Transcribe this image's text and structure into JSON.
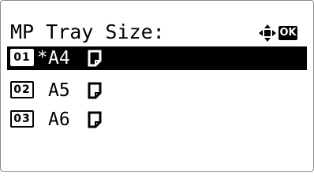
{
  "header": {
    "title": "MP Tray Size:",
    "nav_icon": "four-way-arrow-icon",
    "ok_label": "OK"
  },
  "items": [
    {
      "num": "01",
      "marker": "*",
      "label": "A4",
      "selected": true,
      "icon": "portrait-paper-icon"
    },
    {
      "num": "02",
      "marker": "",
      "label": "A5",
      "selected": false,
      "icon": "portrait-paper-icon"
    },
    {
      "num": "03",
      "marker": "",
      "label": "A6",
      "selected": false,
      "icon": "portrait-paper-icon"
    }
  ]
}
